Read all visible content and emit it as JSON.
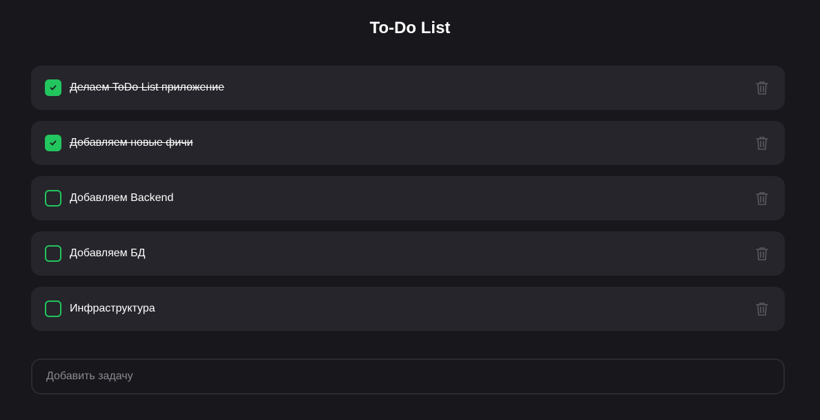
{
  "title": "To-Do List",
  "tasks": [
    {
      "text": "Делаем ToDo List приложение",
      "done": true
    },
    {
      "text": "Добавляем новые фичи",
      "done": true
    },
    {
      "text": "Добавляем Backend",
      "done": false
    },
    {
      "text": "Добавляем БД",
      "done": false
    },
    {
      "text": "Инфраструктура",
      "done": false
    }
  ],
  "input": {
    "placeholder": "Добавить задачу",
    "value": ""
  },
  "colors": {
    "accent": "#22c55e",
    "card": "#26252b",
    "background": "#18171c"
  }
}
